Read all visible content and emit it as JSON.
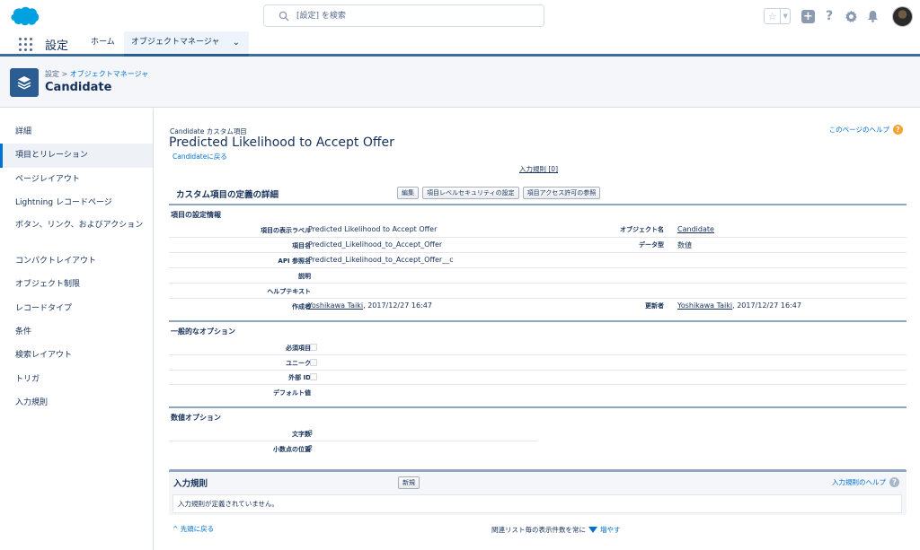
{
  "header": {
    "search_placeholder": "[設定] を検索"
  },
  "nav": {
    "app_name": "設定",
    "tabs": [
      "ホーム",
      "オブジェクトマネージャ"
    ]
  },
  "page_header": {
    "breadcrumb_root": "設定",
    "breadcrumb_sep": ">",
    "breadcrumb_link": "オブジェクトマネージャ",
    "title": "Candidate"
  },
  "sidebar": {
    "items": [
      {
        "label": "詳細",
        "active": false
      },
      {
        "label": "項目とリレーション",
        "active": true
      },
      {
        "label": "ページレイアウト",
        "active": false
      },
      {
        "label": "Lightning レコードページ",
        "active": false
      },
      {
        "label": "ボタン、リンク、およびアクション",
        "active": false
      },
      {
        "label": "コンパクトレイアウト",
        "active": false
      },
      {
        "label": "オブジェクト制限",
        "active": false
      },
      {
        "label": "レコードタイプ",
        "active": false
      },
      {
        "label": "条件",
        "active": false
      },
      {
        "label": "検索レイアウト",
        "active": false
      },
      {
        "label": "トリガ",
        "active": false
      },
      {
        "label": "入力規則",
        "active": false
      }
    ]
  },
  "main": {
    "subtitle": "Candidate カスタム項目",
    "title": "Predicted Likelihood to Accept Offer",
    "back_link": "Candidateに戻る",
    "help_link": "このページのヘルプ",
    "rules_count_link": "入力規則 [0]",
    "detail_section": {
      "title": "カスタム項目の定義の詳細",
      "buttons": [
        "編集",
        "項目レベルセキュリティの設定",
        "項目アクセス許可の参照"
      ]
    },
    "settings": {
      "heading": "項目の設定情報",
      "rows": [
        {
          "label": "項目の表示ラベル",
          "value": "Predicted Likelihood to Accept Offer",
          "label2": "オブジェクト名",
          "value2": "Candidate"
        },
        {
          "label": "項目名",
          "value": "Predicted_Likelihood_to_Accept_Offer",
          "label2": "データ型",
          "value2": "数値"
        },
        {
          "label": "API 参照名",
          "value": "Predicted_Likelihood_to_Accept_Offer__c",
          "label2": "",
          "value2": ""
        },
        {
          "label": "説明",
          "value": "",
          "label2": "",
          "value2": ""
        },
        {
          "label": "ヘルプテキスト",
          "value": "",
          "label2": "",
          "value2": ""
        },
        {
          "label": "作成者",
          "value_user": "Yoshikawa Taiki",
          "value_date": ", 2017/12/27 16:47",
          "label2": "更新者",
          "value2_user": "Yoshikawa Taiki",
          "value2_date": ", 2017/12/27 16:47"
        }
      ]
    },
    "general_options": {
      "heading": "一般的なオプション",
      "rows": [
        {
          "label": "必須項目",
          "checked": false
        },
        {
          "label": "ユニーク",
          "checked": false
        },
        {
          "label": "外部 ID",
          "checked": false
        },
        {
          "label": "デフォルト値",
          "value": ""
        }
      ]
    },
    "number_options": {
      "heading": "数値オプション",
      "rows": [
        {
          "label": "文字数",
          "value": "3"
        },
        {
          "label": "小数点の位置",
          "value": "2"
        }
      ]
    },
    "validation_rules": {
      "title": "入力規則",
      "new_button": "新規",
      "help_link": "入力規則のヘルプ",
      "empty_message": "入力規則が定義されていません。"
    },
    "footer": {
      "back_to_top": "先頭に戻る",
      "list_text": "関連リスト毎の表示件数を常に",
      "more_link": "増やす"
    }
  },
  "colors": {
    "brand": "#0070d2",
    "nav_accent": "#3c6d9a",
    "object_icon": "#2b5d92",
    "help_icon": "#f8a32f"
  }
}
